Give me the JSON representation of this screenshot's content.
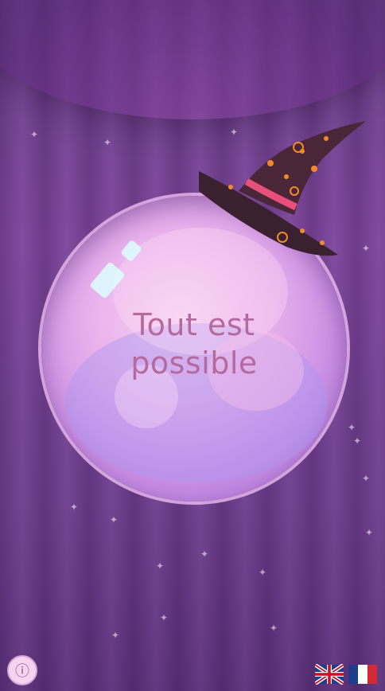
{
  "ball": {
    "message": "Tout est possible",
    "message_line1": "Tout est",
    "message_line2": "possible"
  },
  "decorations": {
    "hat": "witch-hat-icon",
    "background": "purple-curtain"
  },
  "bottom_bar": {
    "info_icon": "info-icon",
    "languages": [
      {
        "code": "en",
        "icon": "uk-flag-icon"
      },
      {
        "code": "fr",
        "icon": "france-flag-icon"
      }
    ]
  },
  "colors": {
    "background": "#6a3a8a",
    "text": "#b46a9e",
    "hat": "#3b2030",
    "hat_band": "#e6507a",
    "hat_dots": "#f08a2a"
  }
}
